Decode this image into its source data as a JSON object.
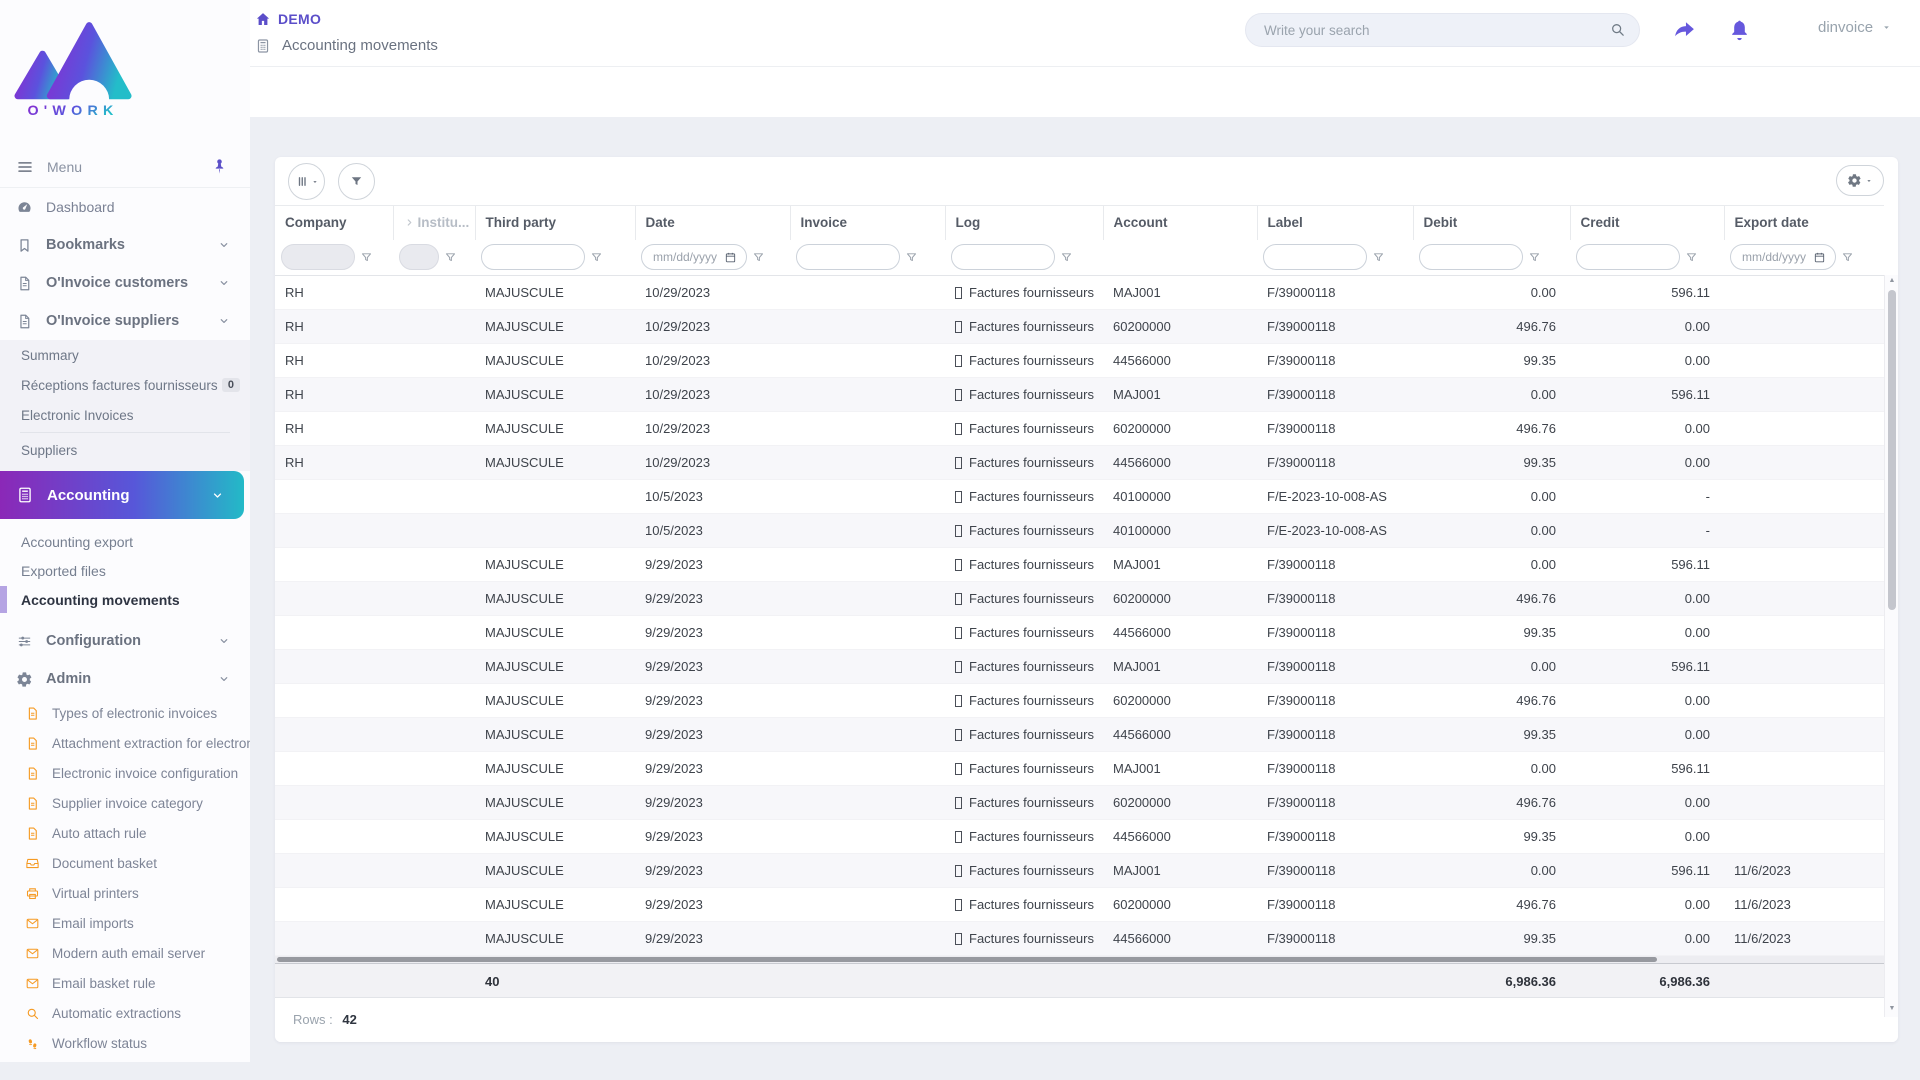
{
  "brand": {
    "logo_text": "O'WORK"
  },
  "topbar": {
    "breadcrumb_title": "DEMO",
    "page_title": "Accounting movements",
    "search_placeholder": "Write your search",
    "user_name": "dinvoice"
  },
  "sidebar": {
    "menu_label": "Menu",
    "items": [
      {
        "label": "Dashboard",
        "icon": "gauge",
        "expandable": false
      },
      {
        "label": "Bookmarks",
        "icon": "bookmark",
        "expandable": true
      },
      {
        "label": "O'Invoice customers",
        "icon": "file",
        "expandable": true
      },
      {
        "label": "O'Invoice suppliers",
        "icon": "file",
        "expandable": true
      }
    ],
    "suppliers_submenu": {
      "items": [
        "Summary",
        "Réceptions factures fournisseurs",
        "Electronic Invoices",
        "Suppliers"
      ],
      "receptions_badge": "0"
    },
    "accounting": {
      "label": "Accounting",
      "icon": "calculator"
    },
    "accounting_submenu": [
      "Accounting export",
      "Exported files",
      "Accounting movements"
    ],
    "active_item": "Accounting movements",
    "settings_items": [
      {
        "label": "Configuration",
        "icon": "sliders"
      },
      {
        "label": "Admin",
        "icon": "gear"
      }
    ],
    "admin_items": [
      {
        "label": "Types of electronic invoices",
        "icon": "doc"
      },
      {
        "label": "Attachment extraction for electron",
        "icon": "doc"
      },
      {
        "label": "Electronic invoice configuration",
        "icon": "doc"
      },
      {
        "label": "Supplier invoice category",
        "icon": "doc"
      },
      {
        "label": "Auto attach rule",
        "icon": "doc"
      },
      {
        "label": "Document basket",
        "icon": "inbox"
      },
      {
        "label": "Virtual printers",
        "icon": "printer"
      },
      {
        "label": "Email imports",
        "icon": "mail"
      },
      {
        "label": "Modern auth email server",
        "icon": "mail"
      },
      {
        "label": "Email basket rule",
        "icon": "mail"
      },
      {
        "label": "Automatic extractions",
        "icon": "magnifier"
      },
      {
        "label": "Workflow status",
        "icon": "footprints"
      }
    ]
  },
  "table": {
    "columns": [
      {
        "label": "Company",
        "key": "company"
      },
      {
        "label": "Institu...",
        "key": "institution",
        "muted": true
      },
      {
        "label": "Third party",
        "key": "third_party"
      },
      {
        "label": "Date",
        "key": "date"
      },
      {
        "label": "Invoice",
        "key": "invoice"
      },
      {
        "label": "Log",
        "key": "log"
      },
      {
        "label": "Account",
        "key": "account"
      },
      {
        "label": "Label",
        "key": "label"
      },
      {
        "label": "Debit",
        "key": "debit"
      },
      {
        "label": "Credit",
        "key": "credit"
      },
      {
        "label": "Export date",
        "key": "export_date"
      }
    ],
    "filters": [
      {
        "type": "text",
        "disabled": true
      },
      {
        "type": "text",
        "disabled": true
      },
      {
        "type": "text"
      },
      {
        "type": "date",
        "placeholder": "mm/dd/yyyy"
      },
      {
        "type": "text"
      },
      {
        "type": "text"
      },
      {
        "type": "none"
      },
      {
        "type": "text"
      },
      {
        "type": "text"
      },
      {
        "type": "text"
      },
      {
        "type": "date",
        "placeholder": "mm/dd/yyyy"
      }
    ],
    "rows": [
      {
        "company": "RH",
        "institution": "",
        "third_party": "MAJUSCULE",
        "date": "10/29/2023",
        "invoice": "",
        "log": "Factures fournisseurs",
        "account": "MAJ001",
        "label": "F/39000118",
        "debit": "0.00",
        "credit": "596.11",
        "export_date": ""
      },
      {
        "company": "RH",
        "institution": "",
        "third_party": "MAJUSCULE",
        "date": "10/29/2023",
        "invoice": "",
        "log": "Factures fournisseurs",
        "account": "60200000",
        "label": "F/39000118",
        "debit": "496.76",
        "credit": "0.00",
        "export_date": ""
      },
      {
        "company": "RH",
        "institution": "",
        "third_party": "MAJUSCULE",
        "date": "10/29/2023",
        "invoice": "",
        "log": "Factures fournisseurs",
        "account": "44566000",
        "label": "F/39000118",
        "debit": "99.35",
        "credit": "0.00",
        "export_date": ""
      },
      {
        "company": "RH",
        "institution": "",
        "third_party": "MAJUSCULE",
        "date": "10/29/2023",
        "invoice": "",
        "log": "Factures fournisseurs",
        "account": "MAJ001",
        "label": "F/39000118",
        "debit": "0.00",
        "credit": "596.11",
        "export_date": ""
      },
      {
        "company": "RH",
        "institution": "",
        "third_party": "MAJUSCULE",
        "date": "10/29/2023",
        "invoice": "",
        "log": "Factures fournisseurs",
        "account": "60200000",
        "label": "F/39000118",
        "debit": "496.76",
        "credit": "0.00",
        "export_date": ""
      },
      {
        "company": "RH",
        "institution": "",
        "third_party": "MAJUSCULE",
        "date": "10/29/2023",
        "invoice": "",
        "log": "Factures fournisseurs",
        "account": "44566000",
        "label": "F/39000118",
        "debit": "99.35",
        "credit": "0.00",
        "export_date": ""
      },
      {
        "company": "",
        "institution": "",
        "third_party": "",
        "date": "10/5/2023",
        "invoice": "",
        "log": "Factures fournisseurs",
        "account": "40100000",
        "label": "F/E-2023-10-008-AS",
        "debit": "0.00",
        "credit": "-",
        "export_date": ""
      },
      {
        "company": "",
        "institution": "",
        "third_party": "",
        "date": "10/5/2023",
        "invoice": "",
        "log": "Factures fournisseurs",
        "account": "40100000",
        "label": "F/E-2023-10-008-AS",
        "debit": "0.00",
        "credit": "-",
        "export_date": ""
      },
      {
        "company": "",
        "institution": "",
        "third_party": "MAJUSCULE",
        "date": "9/29/2023",
        "invoice": "",
        "log": "Factures fournisseurs",
        "account": "MAJ001",
        "label": "F/39000118",
        "debit": "0.00",
        "credit": "596.11",
        "export_date": ""
      },
      {
        "company": "",
        "institution": "",
        "third_party": "MAJUSCULE",
        "date": "9/29/2023",
        "invoice": "",
        "log": "Factures fournisseurs",
        "account": "60200000",
        "label": "F/39000118",
        "debit": "496.76",
        "credit": "0.00",
        "export_date": ""
      },
      {
        "company": "",
        "institution": "",
        "third_party": "MAJUSCULE",
        "date": "9/29/2023",
        "invoice": "",
        "log": "Factures fournisseurs",
        "account": "44566000",
        "label": "F/39000118",
        "debit": "99.35",
        "credit": "0.00",
        "export_date": ""
      },
      {
        "company": "",
        "institution": "",
        "third_party": "MAJUSCULE",
        "date": "9/29/2023",
        "invoice": "",
        "log": "Factures fournisseurs",
        "account": "MAJ001",
        "label": "F/39000118",
        "debit": "0.00",
        "credit": "596.11",
        "export_date": ""
      },
      {
        "company": "",
        "institution": "",
        "third_party": "MAJUSCULE",
        "date": "9/29/2023",
        "invoice": "",
        "log": "Factures fournisseurs",
        "account": "60200000",
        "label": "F/39000118",
        "debit": "496.76",
        "credit": "0.00",
        "export_date": ""
      },
      {
        "company": "",
        "institution": "",
        "third_party": "MAJUSCULE",
        "date": "9/29/2023",
        "invoice": "",
        "log": "Factures fournisseurs",
        "account": "44566000",
        "label": "F/39000118",
        "debit": "99.35",
        "credit": "0.00",
        "export_date": ""
      },
      {
        "company": "",
        "institution": "",
        "third_party": "MAJUSCULE",
        "date": "9/29/2023",
        "invoice": "",
        "log": "Factures fournisseurs",
        "account": "MAJ001",
        "label": "F/39000118",
        "debit": "0.00",
        "credit": "596.11",
        "export_date": ""
      },
      {
        "company": "",
        "institution": "",
        "third_party": "MAJUSCULE",
        "date": "9/29/2023",
        "invoice": "",
        "log": "Factures fournisseurs",
        "account": "60200000",
        "label": "F/39000118",
        "debit": "496.76",
        "credit": "0.00",
        "export_date": ""
      },
      {
        "company": "",
        "institution": "",
        "third_party": "MAJUSCULE",
        "date": "9/29/2023",
        "invoice": "",
        "log": "Factures fournisseurs",
        "account": "44566000",
        "label": "F/39000118",
        "debit": "99.35",
        "credit": "0.00",
        "export_date": ""
      },
      {
        "company": "",
        "institution": "",
        "third_party": "MAJUSCULE",
        "date": "9/29/2023",
        "invoice": "",
        "log": "Factures fournisseurs",
        "account": "MAJ001",
        "label": "F/39000118",
        "debit": "0.00",
        "credit": "596.11",
        "export_date": "11/6/2023"
      },
      {
        "company": "",
        "institution": "",
        "third_party": "MAJUSCULE",
        "date": "9/29/2023",
        "invoice": "",
        "log": "Factures fournisseurs",
        "account": "60200000",
        "label": "F/39000118",
        "debit": "496.76",
        "credit": "0.00",
        "export_date": "11/6/2023"
      },
      {
        "company": "",
        "institution": "",
        "third_party": "MAJUSCULE",
        "date": "9/29/2023",
        "invoice": "",
        "log": "Factures fournisseurs",
        "account": "44566000",
        "label": "F/39000118",
        "debit": "99.35",
        "credit": "0.00",
        "export_date": "11/6/2023"
      }
    ],
    "totals": {
      "third_party": "40",
      "debit": "6,986.36",
      "credit": "6,986.36"
    },
    "rows_label": "Rows :",
    "rows_count": "42"
  },
  "colors": {
    "accent_purple": "#6658dd",
    "gradient_start": "#8b28b7",
    "gradient_end": "#23bac7",
    "icon_orange": "#f59a23"
  }
}
